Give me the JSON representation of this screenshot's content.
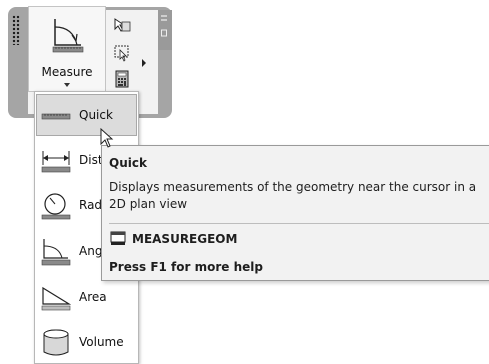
{
  "ribbon": {
    "measure_label": "Measure"
  },
  "menu": {
    "items": [
      {
        "label": "Quick",
        "icon": "ruler-icon",
        "selected": true
      },
      {
        "label": "Dist",
        "icon": "distance-icon"
      },
      {
        "label": "Rad",
        "icon": "radius-icon"
      },
      {
        "label": "Ang",
        "icon": "angle-icon"
      },
      {
        "label": "Area",
        "icon": "area-icon"
      },
      {
        "label": "Volume",
        "icon": "volume-icon"
      }
    ]
  },
  "tooltip": {
    "title": "Quick",
    "description": "Displays measurements of the geometry near the cursor in a 2D plan view",
    "command": "MEASUREGEOM",
    "help": "Press F1 for more help"
  }
}
